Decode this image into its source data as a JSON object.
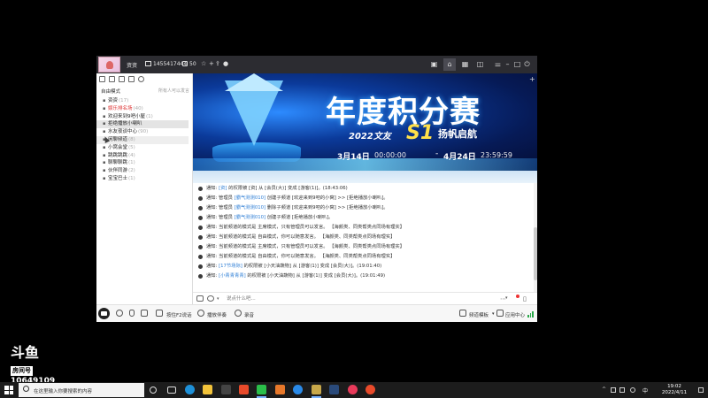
{
  "titlebar": {
    "nickname": "资资",
    "user_id": "1455417444",
    "level": "50"
  },
  "sidebar": {
    "mode_label": "自由模式",
    "mode_tip": "所有人可以发言",
    "channels": [
      {
        "name": "资资",
        "count": "(17)"
      },
      {
        "name": "娱乐排名场",
        "count": "(40)"
      },
      {
        "name": "欢迎来到9吧小屋",
        "count": "(1)"
      },
      {
        "name": "拒绝播放小喇叭",
        "count": ""
      },
      {
        "name": "水友夜谈中心",
        "count": "(90)"
      },
      {
        "name": "闲聊频道",
        "count": "(8)"
      },
      {
        "name": "小窝会堂",
        "count": "(5)"
      },
      {
        "name": "跳跳跳跳",
        "count": "(4)"
      },
      {
        "name": "聊聊聊跳",
        "count": "(1)"
      },
      {
        "name": "伙伴同游",
        "count": "(2)"
      },
      {
        "name": "宝宝巴士",
        "count": "(1)"
      }
    ]
  },
  "banner": {
    "title": "年度积分赛",
    "subtitle": "2022文友",
    "season": "S1",
    "slogan": "扬帆启航",
    "start_date": "3月14日",
    "start_time": "00:00:00",
    "dash": "-",
    "end_date": "4月24日",
    "end_time": "23:59:59"
  },
  "chat": {
    "messages": [
      {
        "pre": "通知: ",
        "hl": "[资]",
        "rest": " 的权限被 [资] 从 [会员(大)] 变成 [游客(1)]。(18:43:06)"
      },
      {
        "pre": "通知: 管理员 ",
        "hl": "[霸气测测010]",
        "rest": " 创建子频道 [欢迎来到9吧的小窝] >> [拒绝播放小喇叭]。"
      },
      {
        "pre": "通知: 管理员 ",
        "hl": "[霸气测测010]",
        "rest": " 删除子频道 [欢迎来到9吧的小窝] >> [拒绝播放小喇叭]。"
      },
      {
        "pre": "通知: 管理员 ",
        "hl": "[霸气测测010]",
        "rest": " 创建子频道 [拒绝播放小喇叭]。"
      },
      {
        "pre": "通知: 当前频道的模式是 主席模式，只有管理员可以发言。 【海颜类、同类帮类点同场有理实】",
        "hl": "",
        "rest": ""
      },
      {
        "pre": "通知: 当前频道的模式是 自由模式，你可以随意发言。 【海颜类、同类帮类点同场有理实】",
        "hl": "",
        "rest": ""
      },
      {
        "pre": "通知: 当前频道的模式是 主席模式，只有管理员可以发言。 【海颜类、同类帮类点同场有理实】",
        "hl": "",
        "rest": ""
      },
      {
        "pre": "通知: 当前频道的模式是 自由模式，你可以随意发言。 【海颜类、同类帮类点同场有理实】",
        "hl": "",
        "rest": ""
      },
      {
        "pre": "通知: ",
        "hl": "[17节场际]",
        "rest": " 的权限被 [小天油蔬物] 从 [游客(1)] 变成 [会员(大)]。(19:01:40)"
      },
      {
        "pre": "通知: ",
        "hl": "[小青青青青]",
        "rest": " 的权限被 [小天油蔬物] 从 [游客(1)] 变成 [会员(大)]。(19:01:49)"
      }
    ]
  },
  "input": {
    "placeholder": "说点什么吧..."
  },
  "bottombar": {
    "mic_mode": "按住F2说话",
    "music": "播放伴奏",
    "record": "录音",
    "channel_setting": "频道模板",
    "app_store": "应用中心"
  },
  "watermark": {
    "logo": "斗鱼",
    "room_label": "房间号",
    "room_number": "10649109"
  },
  "taskbar": {
    "search_placeholder": "在这里输入你要搜索的内容",
    "lang": "中",
    "time": "19:02",
    "date": "2022/4/11"
  }
}
